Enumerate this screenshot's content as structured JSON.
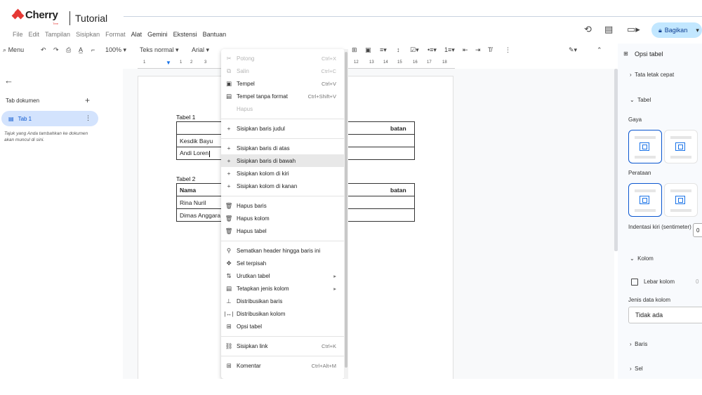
{
  "watermark": {
    "brand": "Cherry",
    "brand_sub": "Tree",
    "title": "Tutorial"
  },
  "menubar": {
    "items": [
      "File",
      "Edit",
      "Tampilan",
      "Sisipkan",
      "Format",
      "Alat",
      "Gemini",
      "Ekstensi",
      "Bantuan"
    ]
  },
  "header": {
    "share_label": "Bagikan"
  },
  "toolbar": {
    "search_label": "Menu",
    "zoom": "100%",
    "style": "Teks normal",
    "font": "Arial"
  },
  "ruler": {
    "ticks": [
      "1",
      "2",
      "1",
      "1",
      "2",
      "3",
      "12",
      "13",
      "14",
      "15",
      "16",
      "17",
      "18"
    ]
  },
  "left_panel": {
    "title": "Tab dokumen",
    "tab1": "Tab 1",
    "note": "Tajuk yang Anda tambahkan ke dokumen akan muncul di sini."
  },
  "document": {
    "table1_caption": "Tabel 1",
    "table1": [
      [
        "",
        "batan"
      ],
      [
        "Kesdik Bayu",
        ""
      ],
      [
        "Andi Loren",
        ""
      ]
    ],
    "table2_caption": "Tabel 2",
    "table2": [
      [
        "Nama",
        "batan"
      ],
      [
        "Rina Nuril",
        ""
      ],
      [
        "Dimas Anggara",
        ""
      ]
    ]
  },
  "context_menu": {
    "items": [
      {
        "label": "Potong",
        "shortcut": "Ctrl+X",
        "icon": "scissors-icon",
        "disabled": true
      },
      {
        "label": "Salin",
        "shortcut": "Ctrl+C",
        "icon": "copy-icon",
        "disabled": true
      },
      {
        "label": "Tempel",
        "shortcut": "Ctrl+V",
        "icon": "paste-icon"
      },
      {
        "label": "Tempel tanpa format",
        "shortcut": "Ctrl+Shift+V",
        "icon": "paste-plain-icon"
      },
      {
        "label": "Hapus",
        "shortcut": "",
        "icon": "trash-icon",
        "disabled": true
      },
      {
        "label": "Sisipkan baris judul",
        "icon": "plus-icon"
      },
      {
        "label": "Sisipkan baris di atas",
        "icon": "plus-icon"
      },
      {
        "label": "Sisipkan baris di bawah",
        "icon": "plus-icon",
        "highlighted": true
      },
      {
        "label": "Sisipkan kolom di kiri",
        "icon": "plus-icon"
      },
      {
        "label": "Sisipkan kolom di kanan",
        "icon": "plus-icon"
      },
      {
        "label": "Hapus baris",
        "icon": "trash-icon"
      },
      {
        "label": "Hapus kolom",
        "icon": "trash-icon"
      },
      {
        "label": "Hapus tabel",
        "icon": "trash-icon"
      },
      {
        "label": "Sematkan header hingga baris ini",
        "icon": "pin-icon"
      },
      {
        "label": "Sel terpisah",
        "icon": "split-cell-icon"
      },
      {
        "label": "Urutkan tabel",
        "icon": "sort-icon",
        "submenu": true
      },
      {
        "label": "Tetapkan jenis kolom",
        "icon": "column-type-icon",
        "submenu": true
      },
      {
        "label": "Distribusikan baris",
        "icon": "distribute-rows-icon"
      },
      {
        "label": "Distribusikan kolom",
        "icon": "distribute-columns-icon"
      },
      {
        "label": "Opsi tabel",
        "icon": "table-icon"
      },
      {
        "label": "Sisipkan link",
        "shortcut": "Ctrl+K",
        "icon": "link-icon"
      },
      {
        "label": "Komentar",
        "shortcut": "Ctrl+Alt+M",
        "icon": "comment-icon"
      }
    ]
  },
  "sidebar": {
    "title": "Opsi tabel",
    "quick_layout": "Tata letak cepat",
    "table_section": "Tabel",
    "style_label": "Gaya",
    "alignment_label": "Perataan",
    "indent_label": "Indentasi kiri (sentimeter)",
    "indent_value": "0",
    "column_section": "Kolom",
    "column_width_label": "Lebar kolom",
    "column_width_value": "0",
    "column_type_label": "Jenis data kolom",
    "column_type_value": "Tidak ada",
    "row_section": "Baris",
    "cell_section": "Sel"
  }
}
